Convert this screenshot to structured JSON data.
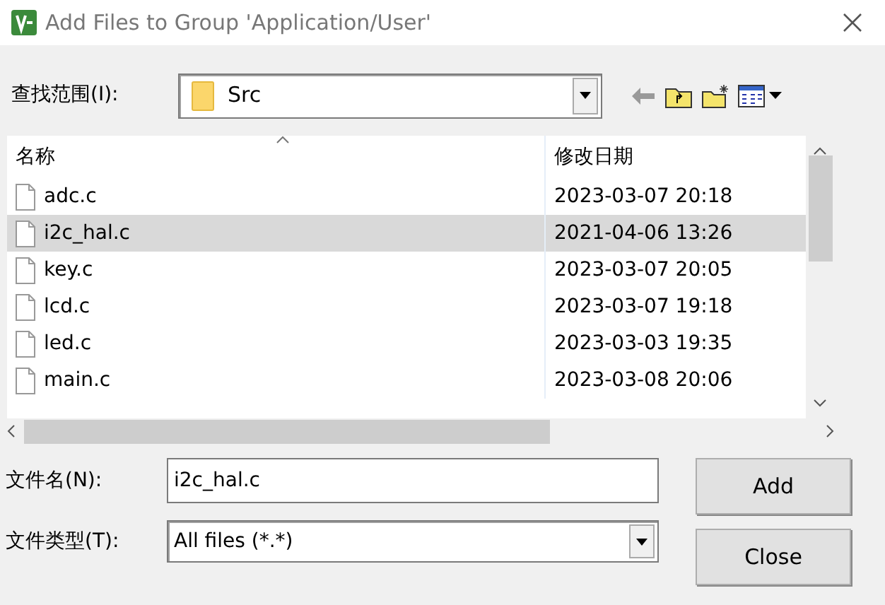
{
  "window": {
    "title": "Add Files to Group 'Application/User'"
  },
  "look_in": {
    "label": "查找范围(I):",
    "value": "Src"
  },
  "columns": [
    "名称",
    "修改日期"
  ],
  "files": [
    {
      "name": "adc.c",
      "modified": "2023-03-07 20:18",
      "selected": false
    },
    {
      "name": "i2c_hal.c",
      "modified": "2021-04-06 13:26",
      "selected": true
    },
    {
      "name": "key.c",
      "modified": "2023-03-07 20:05",
      "selected": false
    },
    {
      "name": "lcd.c",
      "modified": "2023-03-07 19:18",
      "selected": false
    },
    {
      "name": "led.c",
      "modified": "2023-03-03 19:35",
      "selected": false
    },
    {
      "name": "main.c",
      "modified": "2023-03-08 20:06",
      "selected": false
    }
  ],
  "file_name": {
    "label": "文件名(N):",
    "value": "i2c_hal.c"
  },
  "file_type": {
    "label": "文件类型(T):",
    "value": "All files (*.*)"
  },
  "buttons": [
    "Add",
    "Close"
  ]
}
